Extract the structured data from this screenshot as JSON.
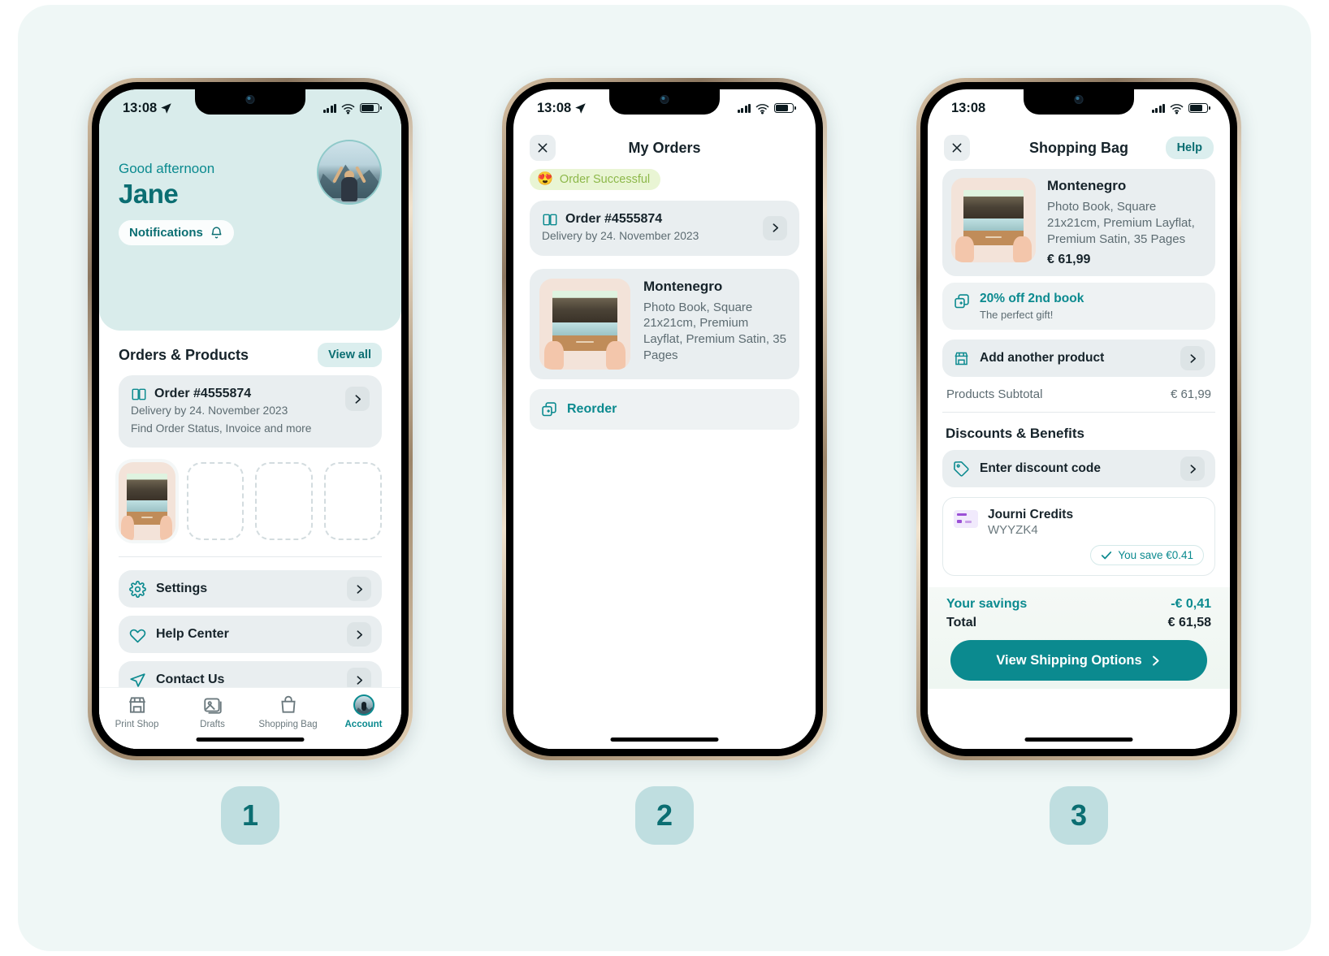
{
  "meta": {
    "accent": "#0b8a8f",
    "hero_bg": "#d9eceb",
    "page_bg": "#eff7f6"
  },
  "status_bar": {
    "time": "13:08"
  },
  "steps": [
    {
      "label": "1"
    },
    {
      "label": "2"
    },
    {
      "label": "3"
    }
  ],
  "phone1": {
    "hero": {
      "greeting": "Good afternoon",
      "name": "Jane",
      "notifications_label": "Notifications",
      "bell_icon": "bell-icon",
      "avatar": "user-avatar"
    },
    "section": {
      "title": "Orders & Products",
      "view_all": "View all"
    },
    "order": {
      "icon": "book-icon",
      "title": "Order #4555874",
      "line1": "Delivery by 24. November 2023",
      "line2": "Find Order Status, Invoice and more"
    },
    "thumbnails": [
      {
        "name": "photo-book-thumbnail",
        "empty": false
      },
      {
        "name": "empty-slot",
        "empty": true
      },
      {
        "name": "empty-slot",
        "empty": true
      },
      {
        "name": "empty-slot",
        "empty": true
      }
    ],
    "menu": [
      {
        "icon": "gear-icon",
        "label": "Settings"
      },
      {
        "icon": "heart-icon",
        "label": "Help Center"
      },
      {
        "icon": "send-icon",
        "label": "Contact Us"
      }
    ],
    "tabs": [
      {
        "icon": "store-icon",
        "label": "Print Shop",
        "active": false
      },
      {
        "icon": "image-icon",
        "label": "Drafts",
        "active": false
      },
      {
        "icon": "bag-icon",
        "label": "Shopping Bag",
        "active": false
      },
      {
        "icon": "avatar-icon",
        "label": "Account",
        "active": true
      }
    ]
  },
  "phone2": {
    "nav": {
      "close_icon": "close-icon",
      "title": "My Orders"
    },
    "status_badge": {
      "emoji": "😍",
      "label": "Order Successful"
    },
    "order": {
      "icon": "book-icon",
      "title": "Order #4555874",
      "line1": "Delivery by 24. November 2023"
    },
    "product": {
      "name": "Montenegro",
      "description": "Photo Book, Square 21x21cm, Premium Layflat, Premium Satin, 35 Pages"
    },
    "reorder": {
      "icon": "copy-plus-icon",
      "label": "Reorder"
    }
  },
  "phone3": {
    "nav": {
      "close_icon": "close-icon",
      "title": "Shopping Bag",
      "help": "Help"
    },
    "product": {
      "name": "Montenegro",
      "description": "Photo Book, Square 21x21cm, Premium Layflat, Premium Satin, 35 Pages",
      "price": "€ 61,99"
    },
    "promo": {
      "icon": "copy-plus-icon",
      "title": "20% off 2nd book",
      "subtitle": "The perfect gift!"
    },
    "add_product": {
      "icon": "store-icon",
      "label": "Add another product"
    },
    "subtotal": {
      "label": "Products Subtotal",
      "value": "€ 61,99"
    },
    "discounts": {
      "title": "Discounts & Benefits",
      "enter_code": {
        "icon": "tag-icon",
        "label": "Enter discount code"
      },
      "credits": {
        "icon": "voucher-icon",
        "name": "Journi Credits",
        "code": "WYYZK4",
        "save_badge": "You save €0.41"
      }
    },
    "totals": {
      "savings_label": "Your savings",
      "savings_value": "-€ 0,41",
      "total_label": "Total",
      "total_value": "€ 61,58"
    },
    "cta": {
      "label": "View Shipping Options"
    }
  }
}
